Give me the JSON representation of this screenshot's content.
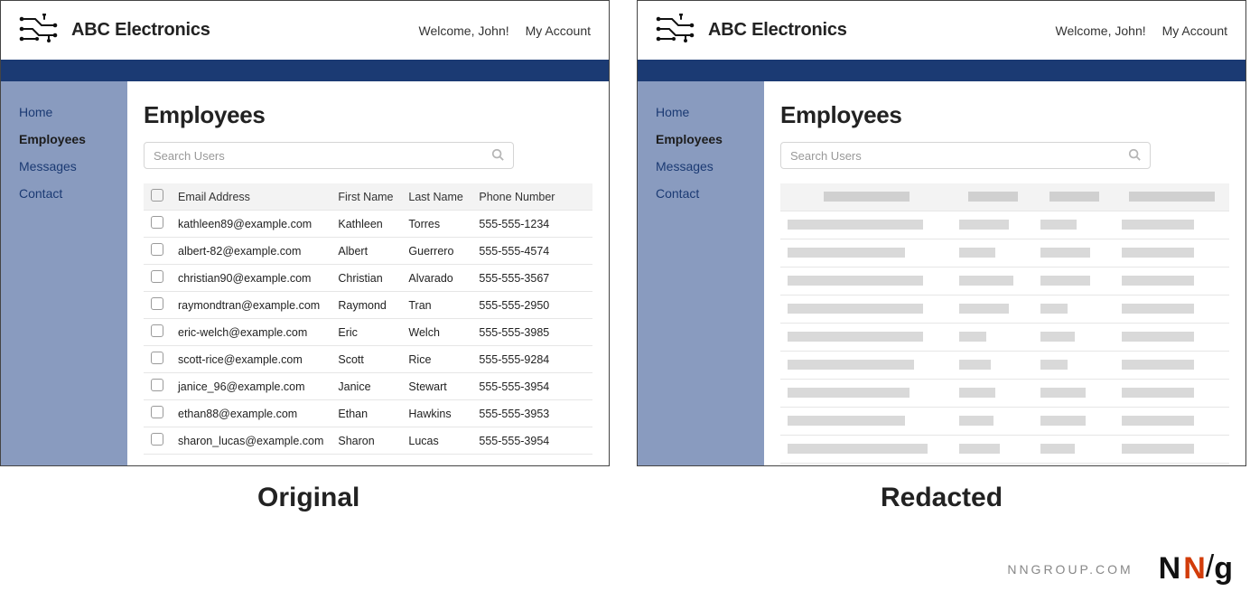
{
  "brand": {
    "name": "ABC Electronics"
  },
  "header": {
    "welcome": "Welcome, John!",
    "account": "My Account"
  },
  "sidebar": {
    "items": [
      {
        "label": "Home"
      },
      {
        "label": "Employees"
      },
      {
        "label": "Messages"
      },
      {
        "label": "Contact"
      }
    ]
  },
  "page": {
    "title": "Employees"
  },
  "search": {
    "placeholder": "Search Users"
  },
  "table": {
    "headers": {
      "email": "Email Address",
      "first": "First Name",
      "last": "Last Name",
      "phone": "Phone Number"
    },
    "rows": [
      {
        "email": "kathleen89@example.com",
        "first": "Kathleen",
        "last": "Torres",
        "phone": "555-555-1234"
      },
      {
        "email": "albert-82@example.com",
        "first": "Albert",
        "last": "Guerrero",
        "phone": "555-555-4574"
      },
      {
        "email": "christian90@example.com",
        "first": "Christian",
        "last": "Alvarado",
        "phone": "555-555-3567"
      },
      {
        "email": "raymondtran@example.com",
        "first": "Raymond",
        "last": "Tran",
        "phone": "555-555-2950"
      },
      {
        "email": "eric-welch@example.com",
        "first": "Eric",
        "last": "Welch",
        "phone": "555-555-3985"
      },
      {
        "email": "scott-rice@example.com",
        "first": "Scott",
        "last": "Rice",
        "phone": "555-555-9284"
      },
      {
        "email": "janice_96@example.com",
        "first": "Janice",
        "last": "Stewart",
        "phone": "555-555-3954"
      },
      {
        "email": "ethan88@example.com",
        "first": "Ethan",
        "last": "Hawkins",
        "phone": "555-555-3953"
      },
      {
        "email": "sharon_lucas@example.com",
        "first": "Sharon",
        "last": "Lucas",
        "phone": "555-555-3954"
      }
    ]
  },
  "captions": {
    "left": "Original",
    "right": "Redacted"
  },
  "footer": {
    "url": "NNGROUP.COM"
  }
}
